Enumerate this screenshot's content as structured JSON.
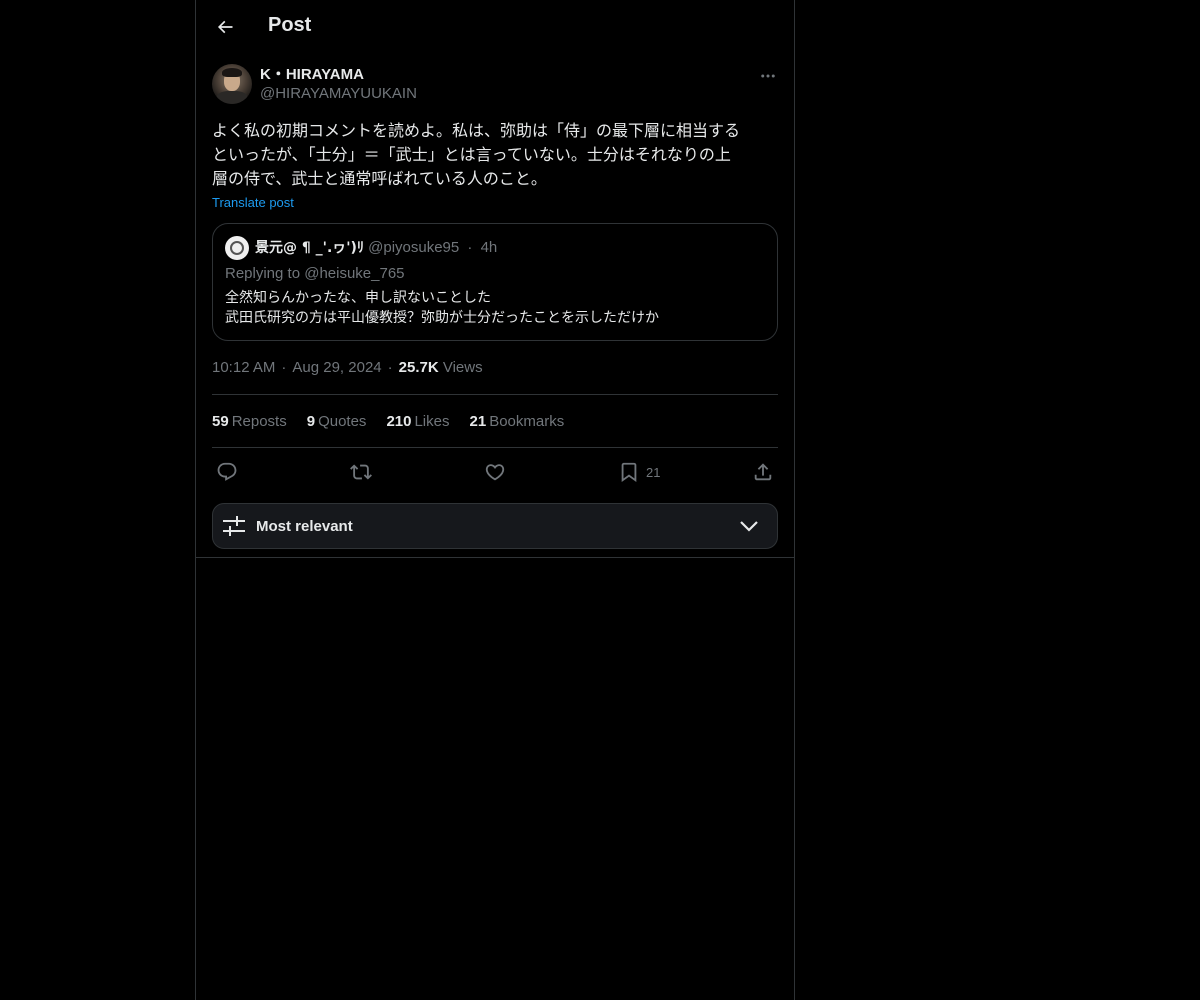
{
  "colors": {
    "background": "#000000",
    "text_primary": "#e7e9ea",
    "text_secondary": "#71767b",
    "link": "#1d9bf0",
    "border": "#2f3336"
  },
  "header": {
    "back_icon": "arrow-left-icon",
    "title": "Post"
  },
  "post": {
    "author_name": "K・HIRAYAMA",
    "author_handle": "@HIRAYAMAYUUKAIN",
    "more_icon": "more-horizontal-icon",
    "text": "よく私の初期コメントを読めよ。私は、弥助は「侍」の最下層に相当する\nといったが、「士分」＝「武士」とは言っていない。士分はそれなりの上\n層の侍で、武士と通常呼ばれている人のこと。",
    "translate_label": "Translate post",
    "quote": {
      "name": "景元@ ¶ _'.ヮ')ﾘ",
      "handle": "@piyosuke95",
      "separator": "·",
      "time": "4h",
      "replying_to": "Replying to @heisuke_765",
      "text": "全然知らんかったな、申し訳ないことした\n武田氏研究の方は平山優教授？弥助が士分だったことを示しただけか"
    },
    "meta": {
      "time": "10:12 AM",
      "separator": "·",
      "date": "Aug 29, 2024",
      "views_count": "25.7K",
      "views_label": "Views"
    },
    "stats": {
      "reposts_count": "59",
      "reposts_label": "Reposts",
      "quotes_count": "9",
      "quotes_label": "Quotes",
      "likes_count": "210",
      "likes_label": "Likes",
      "bookmarks_count": "21",
      "bookmarks_label": "Bookmarks"
    },
    "actions": {
      "reply_icon": "reply-icon",
      "repost_icon": "repost-icon",
      "like_icon": "heart-icon",
      "bookmark_icon": "bookmark-icon",
      "bookmark_count": "21",
      "share_icon": "share-icon"
    }
  },
  "sort": {
    "icon": "sliders-icon",
    "label": "Most relevant",
    "chevron_icon": "chevron-down-icon"
  }
}
